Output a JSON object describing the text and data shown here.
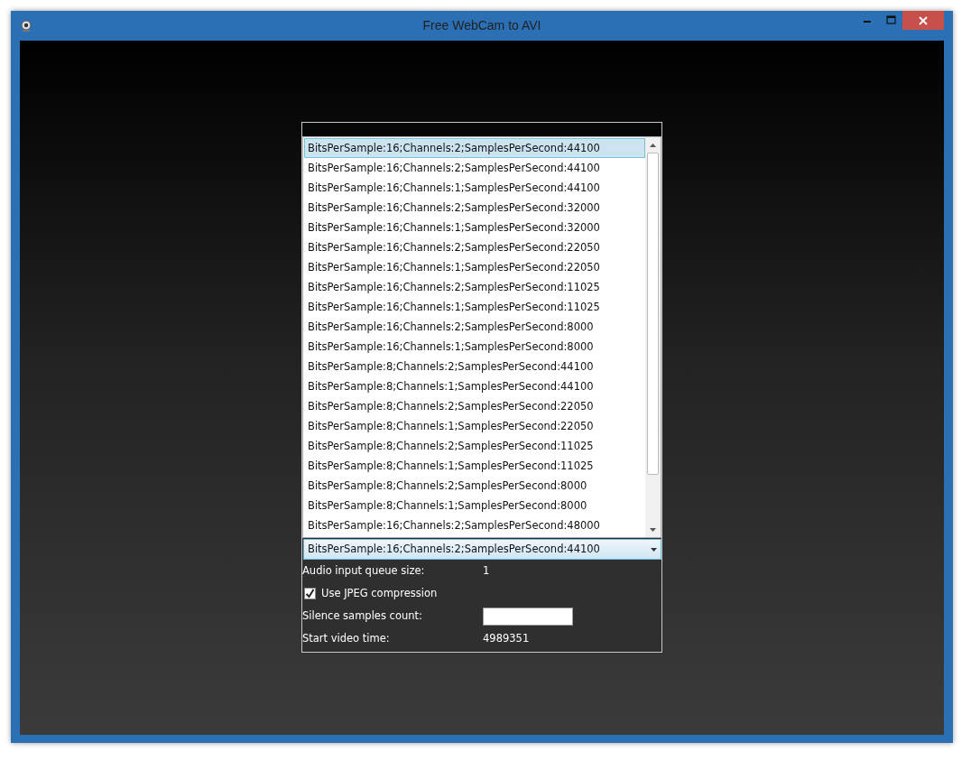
{
  "window": {
    "title": "Free WebCam to AVI"
  },
  "format_list": {
    "items": [
      {
        "label": "BitsPerSample:16;Channels:2;SamplesPerSecond:44100",
        "selected": true
      },
      {
        "label": "BitsPerSample:16;Channels:2;SamplesPerSecond:44100",
        "selected": false
      },
      {
        "label": "BitsPerSample:16;Channels:1;SamplesPerSecond:44100",
        "selected": false
      },
      {
        "label": "BitsPerSample:16;Channels:2;SamplesPerSecond:32000",
        "selected": false
      },
      {
        "label": "BitsPerSample:16;Channels:1;SamplesPerSecond:32000",
        "selected": false
      },
      {
        "label": "BitsPerSample:16;Channels:2;SamplesPerSecond:22050",
        "selected": false
      },
      {
        "label": "BitsPerSample:16;Channels:1;SamplesPerSecond:22050",
        "selected": false
      },
      {
        "label": "BitsPerSample:16;Channels:2;SamplesPerSecond:11025",
        "selected": false
      },
      {
        "label": "BitsPerSample:16;Channels:1;SamplesPerSecond:11025",
        "selected": false
      },
      {
        "label": "BitsPerSample:16;Channels:2;SamplesPerSecond:8000",
        "selected": false
      },
      {
        "label": "BitsPerSample:16;Channels:1;SamplesPerSecond:8000",
        "selected": false
      },
      {
        "label": "BitsPerSample:8;Channels:2;SamplesPerSecond:44100",
        "selected": false
      },
      {
        "label": "BitsPerSample:8;Channels:1;SamplesPerSecond:44100",
        "selected": false
      },
      {
        "label": "BitsPerSample:8;Channels:2;SamplesPerSecond:22050",
        "selected": false
      },
      {
        "label": "BitsPerSample:8;Channels:1;SamplesPerSecond:22050",
        "selected": false
      },
      {
        "label": "BitsPerSample:8;Channels:2;SamplesPerSecond:11025",
        "selected": false
      },
      {
        "label": "BitsPerSample:8;Channels:1;SamplesPerSecond:11025",
        "selected": false
      },
      {
        "label": "BitsPerSample:8;Channels:2;SamplesPerSecond:8000",
        "selected": false
      },
      {
        "label": "BitsPerSample:8;Channels:1;SamplesPerSecond:8000",
        "selected": false
      },
      {
        "label": "BitsPerSample:16;Channels:2;SamplesPerSecond:48000",
        "selected": false
      }
    ]
  },
  "format_combo": {
    "value": "BitsPerSample:16;Channels:2;SamplesPerSecond:44100"
  },
  "settings": [
    {
      "kind": "value",
      "label": "Audio input queue size:",
      "value": "1"
    },
    {
      "kind": "checkbox",
      "label": "Use JPEG compression",
      "checked": true
    },
    {
      "kind": "input",
      "label": "Silence samples count:"
    },
    {
      "kind": "value",
      "label": "Start video time:",
      "value": "4989351"
    }
  ]
}
